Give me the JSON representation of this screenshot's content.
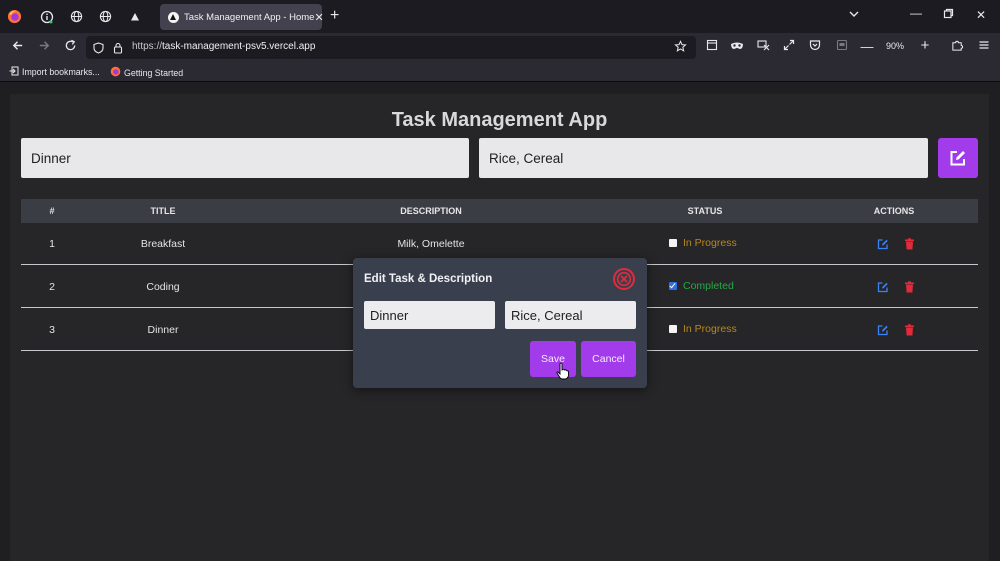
{
  "browser": {
    "active_tab_title": "Task Management App - Home",
    "url_prefix": "https://",
    "url_host": "task-management-psv5.vercel.app",
    "zoom": "90%",
    "bookmarks": [
      {
        "label": "Import bookmarks...",
        "icon": "import-icon"
      },
      {
        "label": "Getting Started",
        "icon": "firefox-icon"
      }
    ]
  },
  "app": {
    "title": "Task Management App",
    "task_input_value": "Dinner",
    "description_input_value": "Rice, Cereal",
    "accent_color": "#a23bea"
  },
  "table": {
    "headers": [
      "#",
      "TITLE",
      "DESCRIPTION",
      "STATUS",
      "ACTIONS"
    ],
    "rows": [
      {
        "num": "1",
        "title": "Breakfast",
        "description": "Milk, Omelette",
        "status": "In Progress",
        "checked": false
      },
      {
        "num": "2",
        "title": "Coding",
        "description": "",
        "status": "Completed",
        "checked": true
      },
      {
        "num": "3",
        "title": "Dinner",
        "description": "",
        "status": "In Progress",
        "checked": false
      }
    ]
  },
  "modal": {
    "title": "Edit Task & Description",
    "task_value": "Dinner",
    "description_value": "Rice, Cereal",
    "save_label": "Save",
    "cancel_label": "Cancel"
  }
}
